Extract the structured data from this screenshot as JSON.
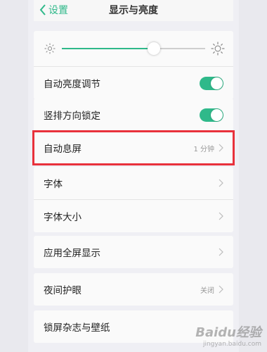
{
  "nav": {
    "back_label": "设置",
    "title": "显示与亮度"
  },
  "brightness": {
    "level": 0.64,
    "auto_label": "自动亮度调节",
    "auto_on": true
  },
  "lock": {
    "label": "竖排方向锁定",
    "on": true
  },
  "sleep": {
    "label": "自动息屏",
    "value": "1 分钟"
  },
  "font": {
    "label": "字体",
    "size_label": "字体大小"
  },
  "fullscreen": {
    "label": "应用全屏显示"
  },
  "night": {
    "label": "夜间护眼",
    "value": "关闭"
  },
  "wallpaper": {
    "label": "锁屏杂志与壁纸"
  },
  "colors": {
    "accent": "#2fb98a",
    "highlight": "#e8313b"
  },
  "watermark": {
    "brand": "Baidu经验",
    "site": "jingyan.baidu.com"
  }
}
